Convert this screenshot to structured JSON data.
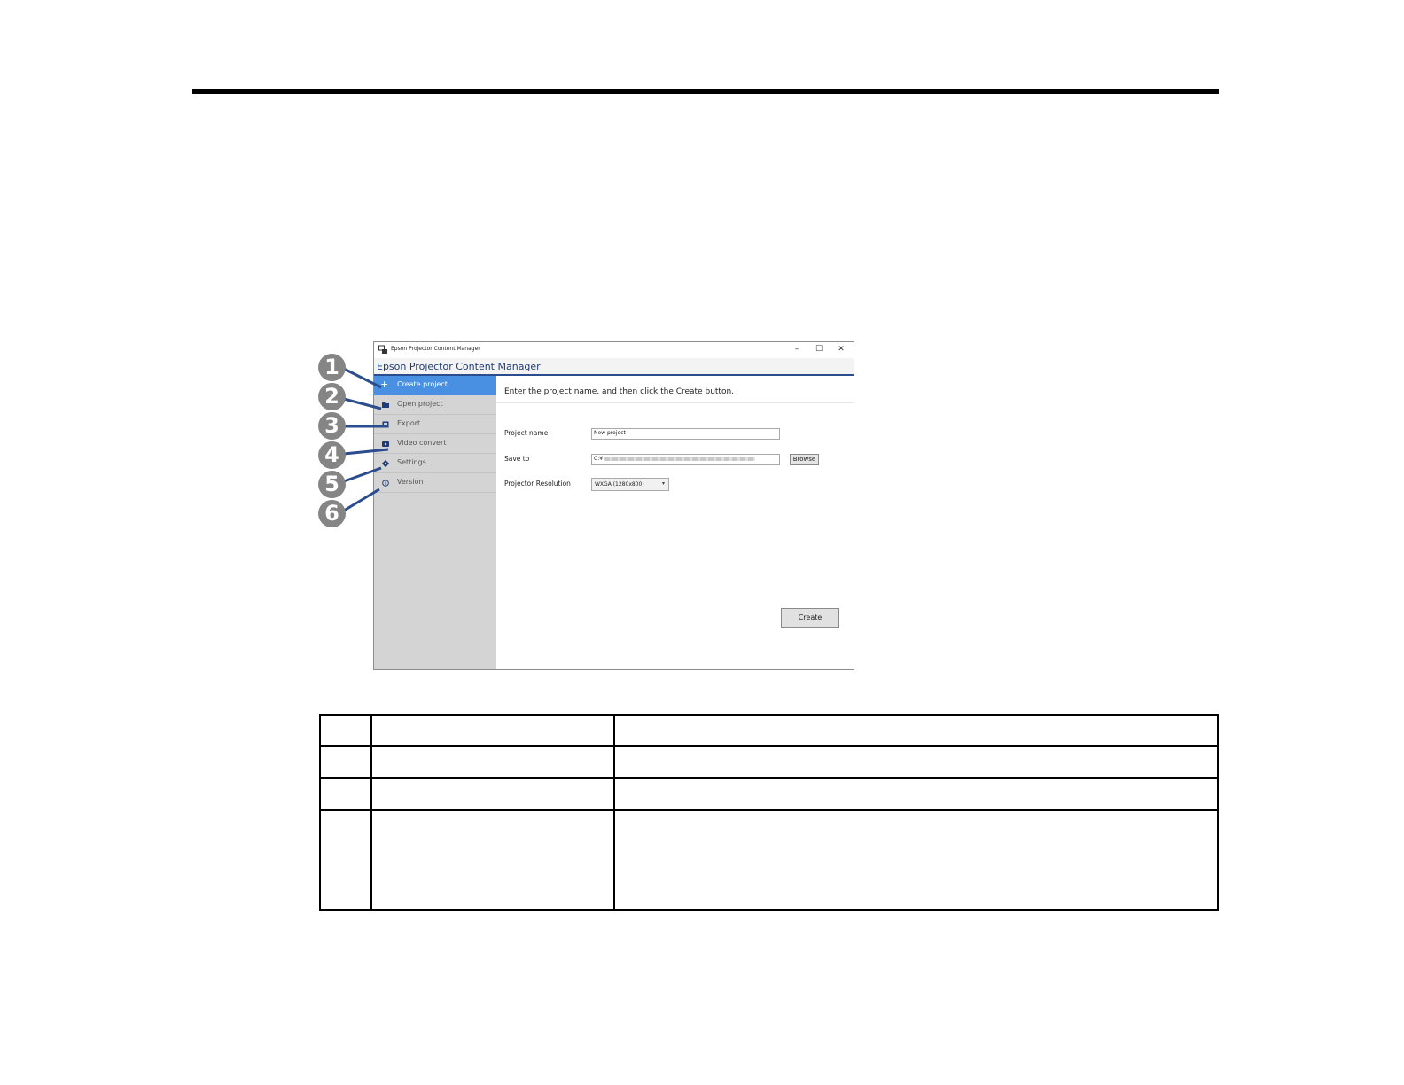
{
  "window": {
    "title": "Epson Projector Content Manager",
    "app_name": "Epson Projector Content Manager",
    "controls": {
      "minimize": "–",
      "maximize": "☐",
      "close": "✕"
    }
  },
  "sidebar": {
    "items": [
      {
        "label": "Create project",
        "icon": "plus-icon",
        "active": true
      },
      {
        "label": "Open project",
        "icon": "folder-icon",
        "active": false
      },
      {
        "label": "Export",
        "icon": "export-icon",
        "active": false
      },
      {
        "label": "Video convert",
        "icon": "video-icon",
        "active": false
      },
      {
        "label": "Settings",
        "icon": "gear-icon",
        "active": false
      },
      {
        "label": "Version",
        "icon": "info-icon",
        "active": false
      }
    ]
  },
  "main": {
    "instruction": "Enter the project name, and then click the Create button.",
    "project_name_label": "Project name",
    "project_name_value": "New project",
    "save_to_label": "Save to",
    "save_to_value": "C:¥",
    "browse_label": "Browse",
    "resolution_label": "Projector Resolution",
    "resolution_value": "WXGA (1280x800)",
    "create_label": "Create"
  },
  "callouts": [
    "1",
    "2",
    "3",
    "4",
    "5",
    "6"
  ],
  "colors": {
    "accent": "#4a90e2",
    "header_text": "#1f3c78",
    "callout": "#858585",
    "callout_line": "#2b4d8d"
  }
}
